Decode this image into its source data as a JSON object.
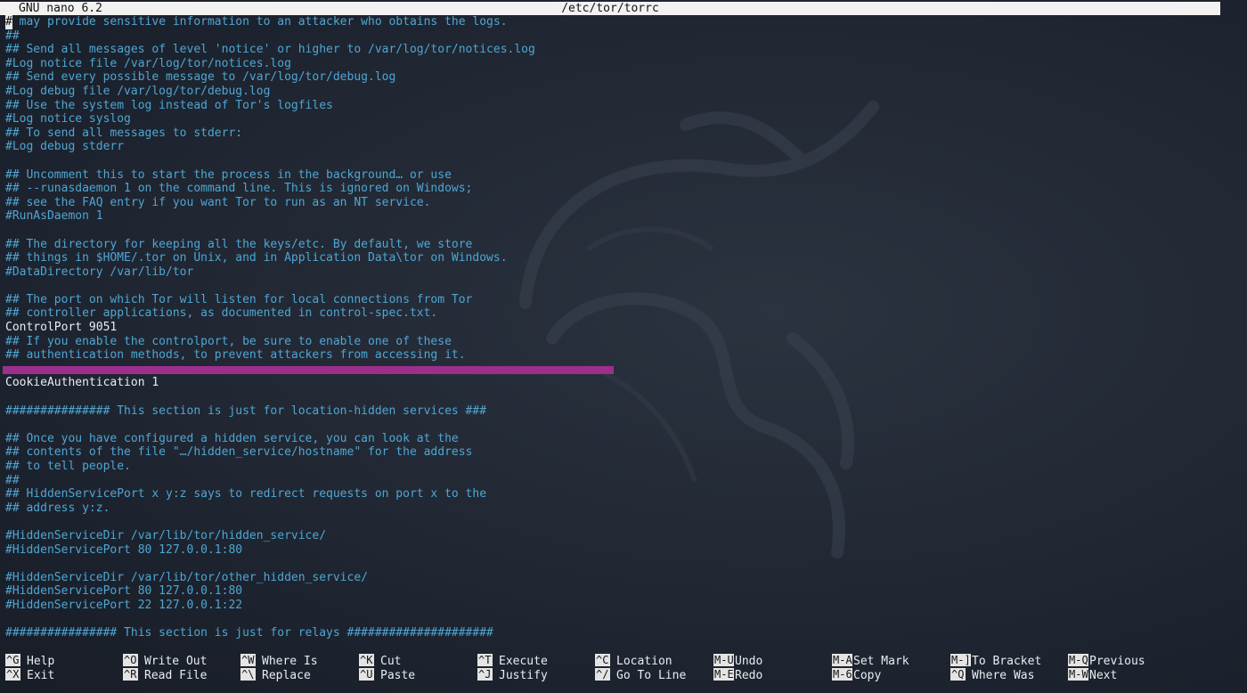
{
  "titlebar": {
    "app": "GNU nano 6.2",
    "file": "/etc/tor/torrc"
  },
  "editor": {
    "cursor_char": "#",
    "lines": [
      "# may provide sensitive information to an attacker who obtains the logs.",
      "##",
      "## Send all messages of level 'notice' or higher to /var/log/tor/notices.log",
      "#Log notice file /var/log/tor/notices.log",
      "## Send every possible message to /var/log/tor/debug.log",
      "#Log debug file /var/log/tor/debug.log",
      "## Use the system log instead of Tor's logfiles",
      "#Log notice syslog",
      "## To send all messages to stderr:",
      "#Log debug stderr",
      "",
      "## Uncomment this to start the process in the background… or use",
      "## --runasdaemon 1 on the command line. This is ignored on Windows;",
      "## see the FAQ entry if you want Tor to run as an NT service.",
      "#RunAsDaemon 1",
      "",
      "## The directory for keeping all the keys/etc. By default, we store",
      "## things in $HOME/.tor on Unix, and in Application Data\\tor on Windows.",
      "#DataDirectory /var/lib/tor",
      "",
      "## The port on which Tor will listen for local connections from Tor",
      "## controller applications, as documented in control-spec.txt.",
      "ControlPort 9051",
      "## If you enable the controlport, be sure to enable one of these",
      "## authentication methods, to prevent attackers from accessing it.",
      "",
      "CookieAuthentication 1",
      "",
      "############### This section is just for location-hidden services ###",
      "",
      "## Once you have configured a hidden service, you can look at the",
      "## contents of the file \"…/hidden_service/hostname\" for the address",
      "## to tell people.",
      "##",
      "## HiddenServicePort x y:z says to redirect requests on port x to the",
      "## address y:z.",
      "",
      "#HiddenServiceDir /var/lib/tor/hidden_service/",
      "#HiddenServicePort 80 127.0.0.1:80",
      "",
      "#HiddenServiceDir /var/lib/tor/other_hidden_service/",
      "#HiddenServicePort 80 127.0.0.1:80",
      "#HiddenServicePort 22 127.0.0.1:22",
      "",
      "################ This section is just for relays #####################"
    ]
  },
  "shortcuts": [
    [
      {
        "key": "^G",
        "label": "Help"
      },
      {
        "key": "^X",
        "label": "Exit"
      }
    ],
    [
      {
        "key": "^O",
        "label": "Write Out"
      },
      {
        "key": "^R",
        "label": "Read File"
      }
    ],
    [
      {
        "key": "^W",
        "label": "Where Is"
      },
      {
        "key": "^\\",
        "label": "Replace"
      }
    ],
    [
      {
        "key": "^K",
        "label": "Cut"
      },
      {
        "key": "^U",
        "label": "Paste"
      }
    ],
    [
      {
        "key": "^T",
        "label": "Execute"
      },
      {
        "key": "^J",
        "label": "Justify"
      }
    ],
    [
      {
        "key": "^C",
        "label": "Location"
      },
      {
        "key": "^/",
        "label": "Go To Line"
      }
    ],
    [
      {
        "key": "M-U",
        "label": "Undo"
      },
      {
        "key": "M-E",
        "label": "Redo"
      }
    ],
    [
      {
        "key": "M-A",
        "label": "Set Mark"
      },
      {
        "key": "M-6",
        "label": "Copy"
      }
    ],
    [
      {
        "key": "M-]",
        "label": "To Bracket"
      },
      {
        "key": "^Q",
        "label": "Where Was"
      }
    ],
    [
      {
        "key": "M-Q",
        "label": "Previous"
      },
      {
        "key": "M-W",
        "label": "Next"
      }
    ]
  ],
  "colors": {
    "comment": "#4ea6d4",
    "directive": "#e9edf2",
    "highlight": "#9c2f8c",
    "titlebar_bg": "#f2f2f2",
    "background": "#1c2330"
  }
}
